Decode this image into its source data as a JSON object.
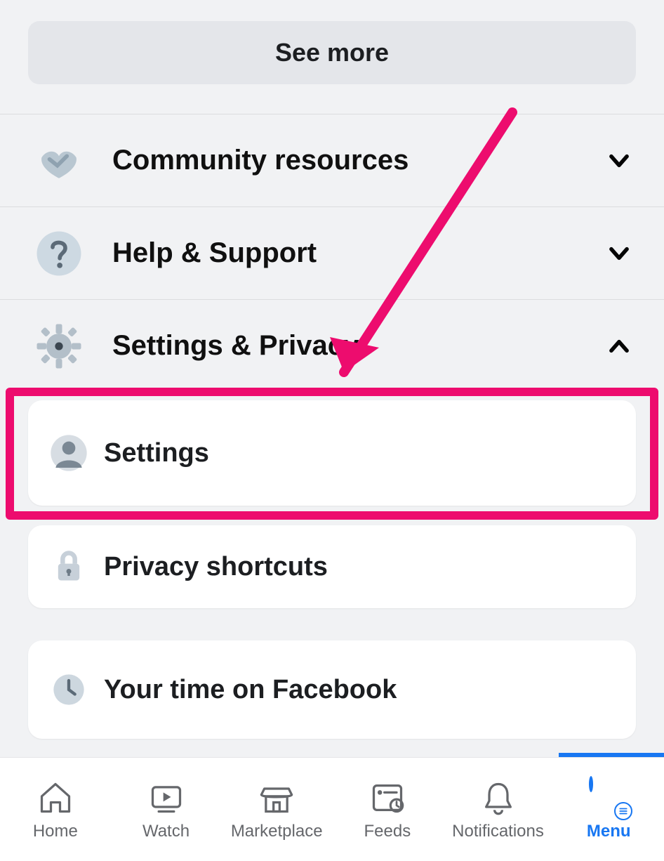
{
  "buttons": {
    "see_more": "See more"
  },
  "sections": {
    "community": {
      "label": "Community resources",
      "expanded": false
    },
    "help": {
      "label": "Help & Support",
      "expanded": false
    },
    "settings": {
      "label": "Settings & Privacy",
      "expanded": true
    }
  },
  "settings_items": {
    "settings": {
      "label": "Settings"
    },
    "privacy": {
      "label": "Privacy shortcuts"
    },
    "time": {
      "label": "Your time on Facebook"
    }
  },
  "tabs": {
    "home": {
      "label": "Home"
    },
    "watch": {
      "label": "Watch"
    },
    "marketplace": {
      "label": "Marketplace"
    },
    "feeds": {
      "label": "Feeds"
    },
    "notifications": {
      "label": "Notifications"
    },
    "menu": {
      "label": "Menu",
      "active": true
    }
  },
  "annotation": {
    "highlight_target": "Settings",
    "color": "#ed0c6e"
  }
}
